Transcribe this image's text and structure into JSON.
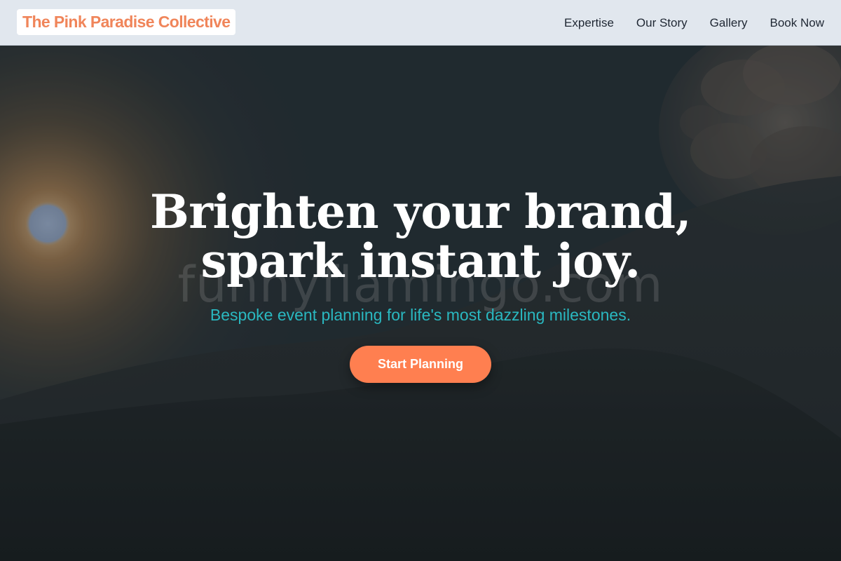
{
  "header": {
    "logo_text": "The Pink Paradise Collective",
    "nav": [
      {
        "label": "Expertise"
      },
      {
        "label": "Our Story"
      },
      {
        "label": "Gallery"
      },
      {
        "label": "Book Now"
      }
    ]
  },
  "hero": {
    "title_line1": "Brighten your brand,",
    "title_line2": "spark instant joy.",
    "subtitle": "Bespoke event planning for life's most dazzling milestones.",
    "cta_label": "Start Planning",
    "watermark": "funnyflamingo.com",
    "background_image": "sunset-mountain-clouds"
  },
  "colors": {
    "accent": "#ff7f50",
    "logo": "#f0855a",
    "subtitle": "#2ab8c0",
    "header_bg": "#e1e7ee"
  }
}
